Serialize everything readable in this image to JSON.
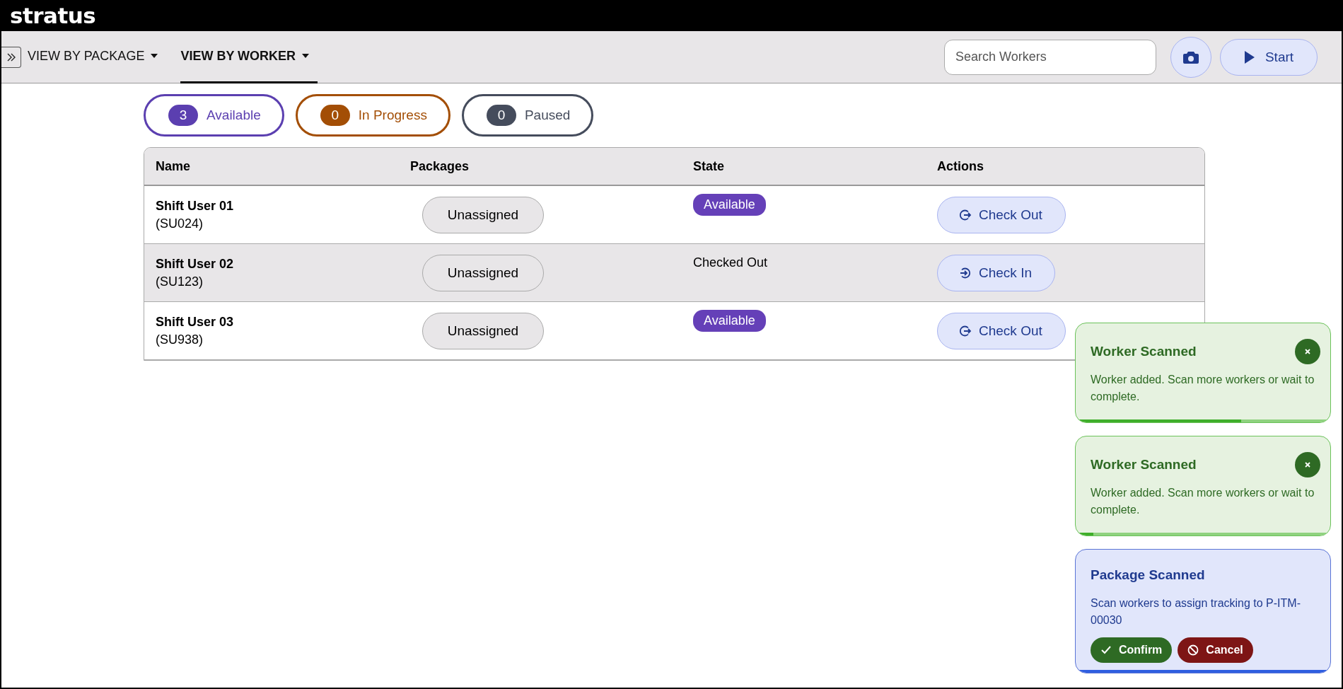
{
  "brand": "stratus",
  "tabs": [
    {
      "label": "VIEW BY PACKAGE",
      "selected": false
    },
    {
      "label": "VIEW BY WORKER",
      "selected": true
    }
  ],
  "search": {
    "placeholder": "Search Workers"
  },
  "start_button": "Start",
  "filters": [
    {
      "count": "3",
      "label": "Available",
      "color": "#5b3fb0"
    },
    {
      "count": "0",
      "label": "In Progress",
      "color": "#a34e05"
    },
    {
      "count": "0",
      "label": "Paused",
      "color": "#454c5c"
    }
  ],
  "table": {
    "columns": [
      "Name",
      "Packages",
      "State",
      "Actions"
    ],
    "rows": [
      {
        "name": "Shift User 01",
        "code": "(SU024)",
        "package": "Unassigned",
        "state": {
          "kind": "badge",
          "text": "Available"
        },
        "action": {
          "kind": "check-out",
          "label": "Check Out"
        },
        "selected": false
      },
      {
        "name": "Shift User 02",
        "code": "(SU123)",
        "package": "Unassigned",
        "state": {
          "kind": "plain",
          "text": "Checked Out"
        },
        "action": {
          "kind": "check-in",
          "label": "Check In"
        },
        "selected": true
      },
      {
        "name": "Shift User 03",
        "code": "(SU938)",
        "package": "Unassigned",
        "state": {
          "kind": "badge",
          "text": "Available"
        },
        "action": {
          "kind": "check-out",
          "label": "Check Out"
        },
        "selected": false
      }
    ]
  },
  "toasts": [
    {
      "kind": "success",
      "title": "Worker Scanned",
      "message": "Worker added. Scan more workers or wait to complete.",
      "level": 0.65
    },
    {
      "kind": "success",
      "title": "Worker Scanned",
      "message": "Worker added. Scan more workers or wait to complete.",
      "level": 0.07
    },
    {
      "kind": "info",
      "title": "Package Scanned",
      "message": "Scan workers to assign tracking to P-ITM-00030",
      "level": 1,
      "buttons": [
        {
          "kind": "confirm",
          "label": "Confirm"
        },
        {
          "kind": "cancel",
          "label": "Cancel"
        }
      ]
    }
  ]
}
